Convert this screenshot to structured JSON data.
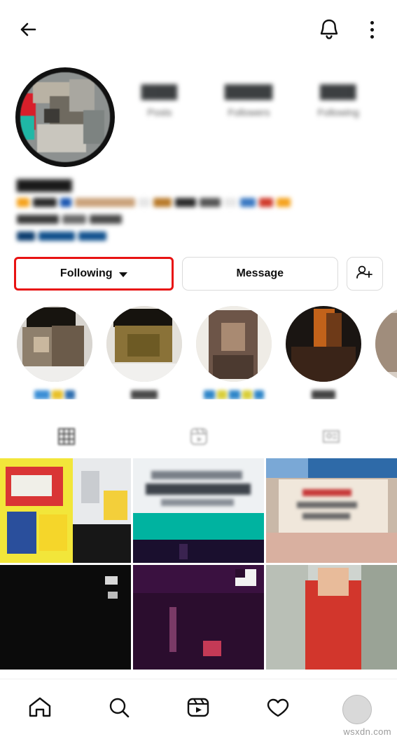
{
  "app": {
    "platform": "instagram-profile",
    "watermark": "wsxdn.com"
  },
  "topbar": {
    "back_icon": "back-arrow-icon",
    "notifications_icon": "bell-icon",
    "menu_icon": "kebab-menu-icon"
  },
  "profile": {
    "avatar_icon": "profile-avatar",
    "username_redacted": "▇▇▇▇▇▇",
    "bio_line_1": "▇▇ ▇▇▇▇▇▇▇▇ ▇▇▇ ▇▇▇▇▇▇ ▇▇▇",
    "bio_line_2": "▇▇▇▇▇▇▇▇▇▇",
    "bio_line_3": "▇▇▇▇▇▇▇",
    "stats": [
      {
        "value": "▇▇▇",
        "label": "Posts"
      },
      {
        "value": "▇▇▇▇",
        "label": "Followers"
      },
      {
        "value": "▇▇▇",
        "label": "Following"
      }
    ]
  },
  "actions": {
    "following_label": "Following",
    "following_chevron": "chevron-down-icon",
    "message_label": "Message",
    "add_user_icon": "add-person-icon"
  },
  "highlights": [
    {
      "label": "▇▇▇▇"
    },
    {
      "label": "▇▇▇"
    },
    {
      "label": "▇▇▇▇▇▇"
    },
    {
      "label": "▇▇▇▇"
    },
    {
      "label": "▇▇"
    }
  ],
  "tabs": [
    {
      "name": "grid-tab",
      "icon": "grid-icon",
      "selected": true
    },
    {
      "name": "reels-tab",
      "icon": "reels-icon",
      "selected": false
    },
    {
      "name": "tagged-tab",
      "icon": "tagged-icon",
      "selected": false
    }
  ],
  "grid_posts": [
    {
      "name": "post-1"
    },
    {
      "name": "post-2"
    },
    {
      "name": "post-3"
    },
    {
      "name": "post-4"
    },
    {
      "name": "post-5"
    },
    {
      "name": "post-6"
    }
  ],
  "bottom_nav": [
    {
      "name": "home-tab",
      "icon": "home-icon"
    },
    {
      "name": "search-tab",
      "icon": "search-icon"
    },
    {
      "name": "reels-tab",
      "icon": "reels-play-icon"
    },
    {
      "name": "activity-tab",
      "icon": "heart-icon"
    },
    {
      "name": "profile-tab",
      "icon": "profile-avatar-icon"
    }
  ],
  "colors": {
    "accent_red": "#e81313",
    "border": "#dbdbdb",
    "text": "#0f0f0f"
  }
}
